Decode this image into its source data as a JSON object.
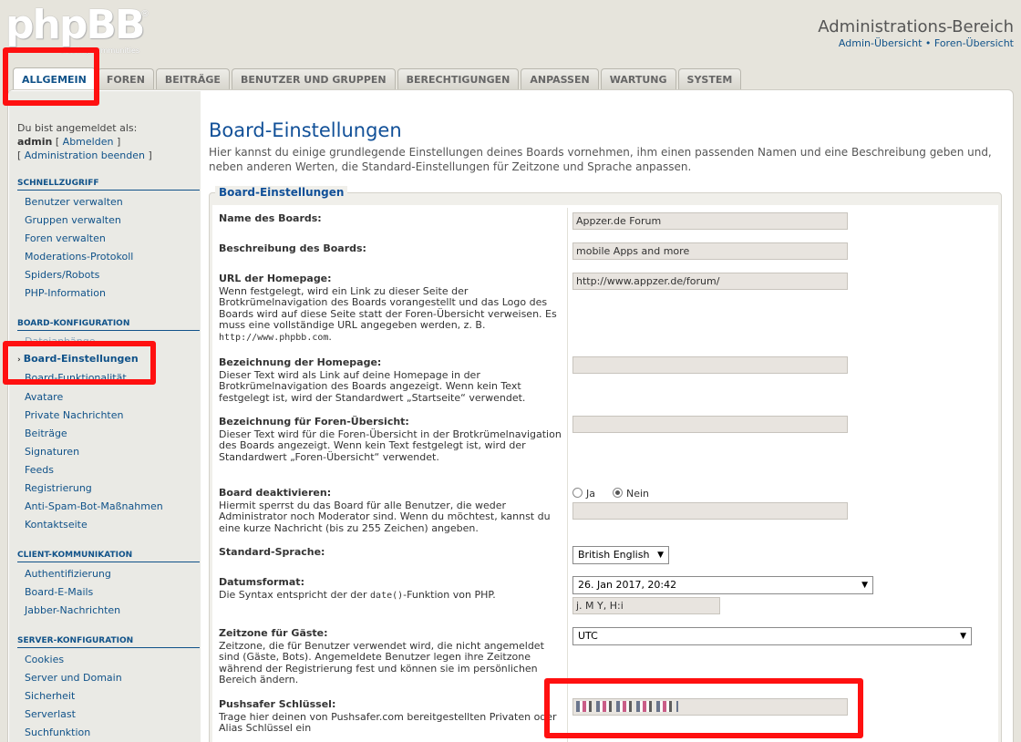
{
  "header": {
    "logo_text": "phpBB",
    "logo_reg": "®",
    "logo_tagline": "creating communities",
    "acp_title": "Administrations-Bereich",
    "link_admin": "Admin-Übersicht",
    "link_sep": " • ",
    "link_forum": "Foren-Übersicht"
  },
  "tabs": [
    {
      "label": "ALLGEMEIN"
    },
    {
      "label": "FOREN"
    },
    {
      "label": "BEITRÄGE"
    },
    {
      "label": "BENUTZER UND GRUPPEN"
    },
    {
      "label": "BERECHTIGUNGEN"
    },
    {
      "label": "ANPASSEN"
    },
    {
      "label": "WARTUNG"
    },
    {
      "label": "SYSTEM"
    }
  ],
  "sidebar": {
    "logged_in_as": "Du bist angemeldet als:",
    "username": "admin",
    "logout": "Abmelden",
    "end_admin": "Administration beenden",
    "quick_head": "SCHNELLZUGRIFF",
    "quick": [
      "Benutzer verwalten",
      "Gruppen verwalten",
      "Foren verwalten",
      "Moderations-Protokoll",
      "Spiders/Robots",
      "PHP-Information"
    ],
    "board_head": "BOARD-KONFIGURATION",
    "board_partial_top": "Dateianhänge",
    "board_active": "Board-Einstellungen",
    "board_partial_bottom": "Board-Funktionalität",
    "board": [
      "Avatare",
      "Private Nachrichten",
      "Beiträge",
      "Signaturen",
      "Feeds",
      "Registrierung",
      "Anti-Spam-Bot-Maßnahmen",
      "Kontaktseite"
    ],
    "client_head": "CLIENT-KOMMUNIKATION",
    "client": [
      "Authentifizierung",
      "Board-E-Mails",
      "Jabber-Nachrichten"
    ],
    "server_head": "SERVER-KONFIGURATION",
    "server": [
      "Cookies",
      "Server und Domain",
      "Sicherheit",
      "Serverlast",
      "Suchfunktion"
    ]
  },
  "main": {
    "title": "Board-Einstellungen",
    "description": "Hier kannst du einige grundlegende Einstellungen deines Boards vornehmen, ihm einen passenden Namen und eine Beschreibung geben und, neben anderen Werten, die Standard-Einstellungen für Zeitzone und Sprache anpassen.",
    "legend": "Board-Einstellungen"
  },
  "fields": {
    "name": {
      "label": "Name des Boards:",
      "value": "Appzer.de Forum"
    },
    "desc": {
      "label": "Beschreibung des Boards:",
      "value": "mobile Apps and more"
    },
    "url": {
      "label": "URL der Homepage:",
      "help": "Wenn festgelegt, wird ein Link zu dieser Seite der Brotkrümelnavigation des Boards vorangestellt und das Logo des Boards wird auf diese Seite statt der Foren-Übersicht verweisen. Es muss eine vollständige URL angegeben werden, z. B.",
      "example": "http://www.phpbb.com",
      "example_end": ".",
      "value": "http://www.appzer.de/forum/"
    },
    "homepage_name": {
      "label": "Bezeichnung der Homepage:",
      "help": "Dieser Text wird als Link auf deine Homepage in der Brotkrümelnavigation des Boards angezeigt. Wenn kein Text festgelegt ist, wird der Standardwert „Startseite“ verwendet.",
      "value": ""
    },
    "index_name": {
      "label": "Bezeichnung für Foren-Übersicht:",
      "help": "Dieser Text wird für die Foren-Übersicht in der Brotkrümelnavigation des Boards angezeigt. Wenn kein Text festgelegt ist, wird der Standardwert „Foren-Übersicht“ verwendet.",
      "value": ""
    },
    "disable": {
      "label": "Board deaktivieren:",
      "help": "Hiermit sperrst du das Board für alle Benutzer, die weder Administrator noch Moderator sind. Wenn du möchtest, kannst du eine kurze Nachricht (bis zu 255 Zeichen) angeben.",
      "yes": "Ja",
      "no": "Nein",
      "value": ""
    },
    "language": {
      "label": "Standard-Sprache:",
      "value": "British English"
    },
    "dateformat": {
      "label": "Datumsformat:",
      "help_pre": "Die Syntax entspricht der der ",
      "help_code": "date()",
      "help_post": "-Funktion von PHP.",
      "value": "26. Jan 2017, 20:42",
      "custom": "j. M Y, H:i"
    },
    "timezone": {
      "label": "Zeitzone für Gäste:",
      "help": "Zeitzone, die für Benutzer verwendet wird, die nicht angemeldet sind (Gäste, Bots). Angemeldete Benutzer legen ihre Zeitzone während der Registrierung fest und können sie im persönlichen Bereich ändern.",
      "value": "UTC"
    },
    "pushsafer": {
      "label": "Pushsafer Schlüssel:",
      "help": "Trage hier deinen von Pushsafer.com bereitgestellten Privaten oder Alias Schlüssel ein"
    }
  },
  "colors": {
    "highlight": "#ff1010",
    "link": "#105289",
    "title": "#115098"
  }
}
